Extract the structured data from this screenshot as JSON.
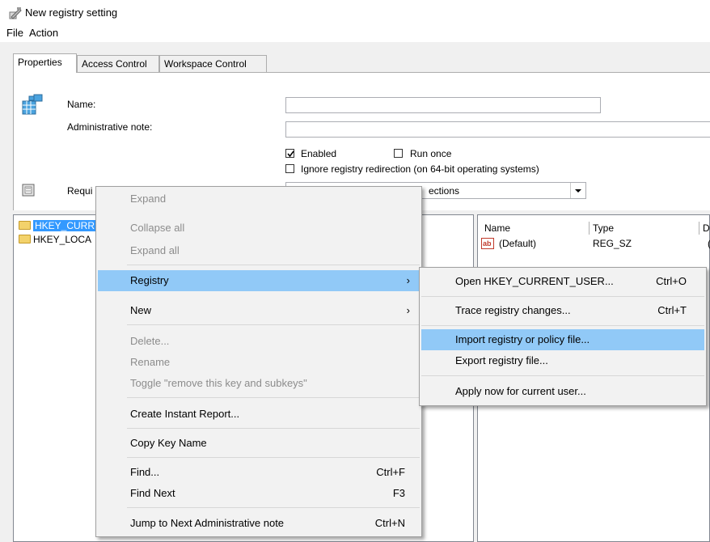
{
  "window": {
    "title": "New registry setting"
  },
  "menubar": [
    "File",
    "Action"
  ],
  "tabs": [
    {
      "label": "Properties",
      "active": true
    },
    {
      "label": "Access Control",
      "active": false
    },
    {
      "label": "Workspace Control",
      "active": false
    }
  ],
  "form": {
    "name_label": "Name:",
    "name_value": "",
    "note_label": "Administrative note:",
    "note_value": "",
    "enabled_label": "Enabled",
    "enabled_checked": true,
    "run_once_label": "Run once",
    "run_once_checked": false,
    "ignore_label": "Ignore registry redirection (on 64-bit operating systems)",
    "ignore_checked": false,
    "required_label_visible": "Requi",
    "dropdown_visible": "ections"
  },
  "tree": [
    "HKEY_CURR",
    "HKEY_LOCA"
  ],
  "list": {
    "columns": [
      "Name",
      "Type",
      "D"
    ],
    "rows": [
      {
        "name": "(Default)",
        "type": "REG_SZ",
        "data": "("
      }
    ]
  },
  "context_menu": {
    "items": [
      {
        "label": "Expand",
        "disabled": true
      },
      {
        "label": "Collapse all",
        "disabled": true
      },
      {
        "label": "Expand all",
        "disabled": true
      },
      {
        "label": "Registry",
        "submenu": true,
        "highlighted": true
      },
      {
        "label": "New",
        "submenu": true
      },
      {
        "label": "Delete...",
        "disabled": true
      },
      {
        "label": "Rename",
        "disabled": true
      },
      {
        "label": "Toggle \"remove this key and subkeys\"",
        "disabled": true
      },
      {
        "label": "Create Instant Report..."
      },
      {
        "label": "Copy Key Name"
      },
      {
        "label": "Find...",
        "shortcut": "Ctrl+F"
      },
      {
        "label": "Find Next",
        "shortcut": "F3"
      },
      {
        "label": "Jump to Next Administrative note",
        "shortcut": "Ctrl+N"
      }
    ],
    "arrow": "›"
  },
  "registry_submenu": {
    "items": [
      {
        "label": "Open HKEY_CURRENT_USER...",
        "shortcut": "Ctrl+O"
      },
      {
        "label": "Trace registry changes...",
        "shortcut": "Ctrl+T"
      },
      {
        "label": "Import registry or policy file...",
        "highlighted": true
      },
      {
        "label": "Export registry file..."
      },
      {
        "label": "Apply now for current user..."
      }
    ]
  },
  "colors": {
    "highlight": "#91c9f7",
    "selection": "#3399ff",
    "disabled": "#8c8c8c"
  }
}
